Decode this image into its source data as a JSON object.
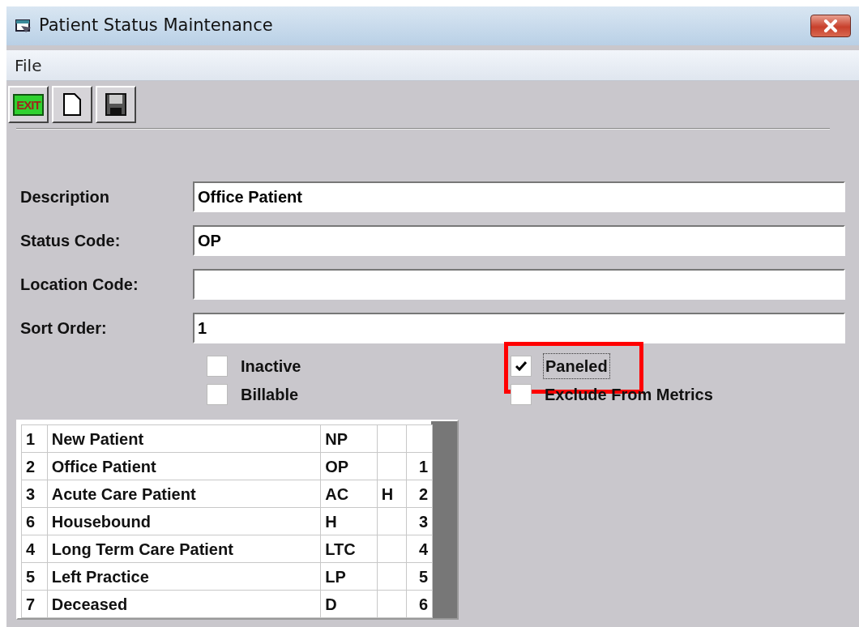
{
  "window": {
    "title": "Patient Status Maintenance"
  },
  "menu": [
    {
      "label": "File"
    }
  ],
  "toolbar": [
    {
      "kind": "exit",
      "label": "EXIT"
    },
    {
      "kind": "new"
    },
    {
      "kind": "save"
    }
  ],
  "fields": [
    {
      "label": "Description",
      "value": "Office Patient"
    },
    {
      "label": "Status Code:",
      "value": "OP"
    },
    {
      "label": "Location Code:"
    },
    {
      "label": "Sort Order:",
      "value": "1"
    }
  ],
  "checkboxes": [
    {
      "label": "Inactive",
      "checked": false,
      "highlighted": false
    },
    {
      "label": "Paneled",
      "checked": true,
      "highlighted": true
    },
    {
      "label": "Billable",
      "checked": false,
      "highlighted": false
    },
    {
      "label": "Exclude From Metrics",
      "checked": false,
      "highlighted": false
    }
  ],
  "table": {
    "rows": [
      [
        "1",
        "New Patient",
        "NP",
        "",
        ""
      ],
      [
        "2",
        "Office Patient",
        "OP",
        "",
        "1"
      ],
      [
        "3",
        "Acute Care Patient",
        "AC",
        "H",
        "2"
      ],
      [
        "6",
        "Housebound",
        "H",
        "",
        "3"
      ],
      [
        "4",
        "Long Term Care Patient",
        "LTC",
        "",
        "4"
      ],
      [
        "5",
        "Left Practice",
        "LP",
        "",
        "5"
      ],
      [
        "7",
        "Deceased",
        "D",
        "",
        "6"
      ]
    ]
  }
}
